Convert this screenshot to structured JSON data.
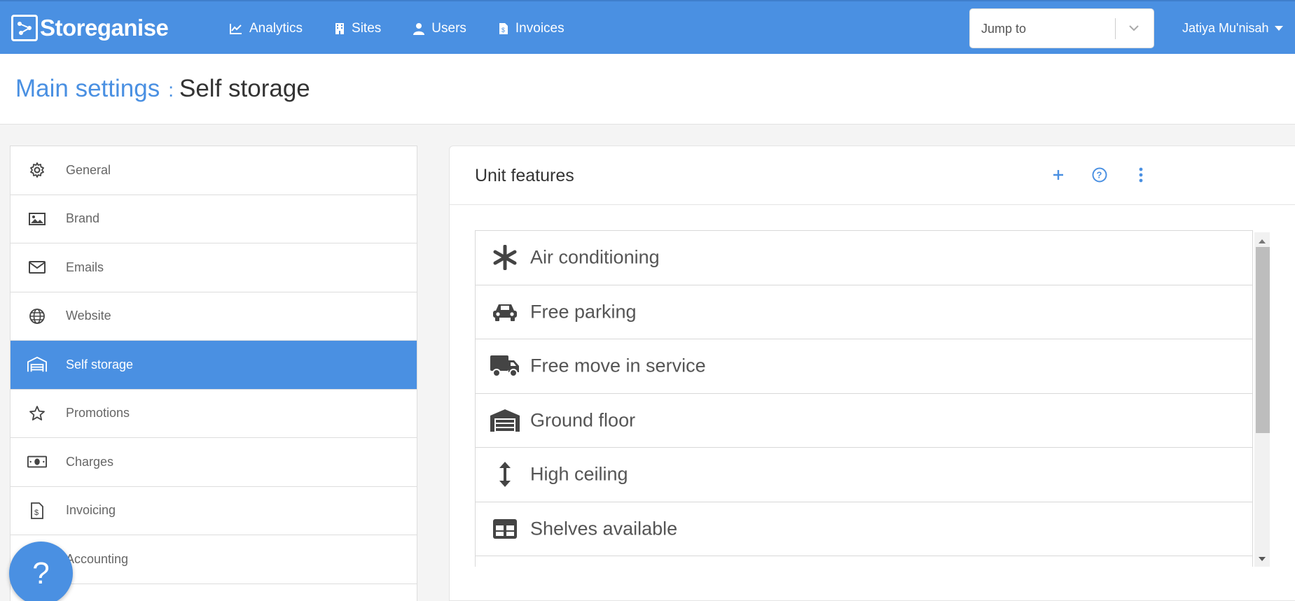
{
  "app": {
    "name": "Storeganise"
  },
  "nav": [
    {
      "label": "Analytics",
      "icon": "chart-line-icon"
    },
    {
      "label": "Sites",
      "icon": "building-icon"
    },
    {
      "label": "Users",
      "icon": "user-icon"
    },
    {
      "label": "Invoices",
      "icon": "invoice-icon"
    }
  ],
  "jump": {
    "placeholder": "Jump to"
  },
  "user": {
    "name": "Jatiya Mu'nisah"
  },
  "breadcrumb": {
    "parent": "Main settings",
    "separator": ":",
    "current": "Self storage"
  },
  "sidebar": {
    "items": [
      {
        "label": "General",
        "icon": "gear-icon",
        "active": false
      },
      {
        "label": "Brand",
        "icon": "image-icon",
        "active": false
      },
      {
        "label": "Emails",
        "icon": "envelope-icon",
        "active": false
      },
      {
        "label": "Website",
        "icon": "globe-icon",
        "active": false
      },
      {
        "label": "Self storage",
        "icon": "warehouse-icon",
        "active": true
      },
      {
        "label": "Promotions",
        "icon": "star-icon",
        "active": false
      },
      {
        "label": "Charges",
        "icon": "money-icon",
        "active": false
      },
      {
        "label": "Invoicing",
        "icon": "invoice-icon",
        "active": false
      },
      {
        "label": "Accounting",
        "icon": "accounting-icon",
        "active": false
      }
    ]
  },
  "help": {
    "label": "?"
  },
  "card": {
    "title": "Unit features",
    "actions": [
      "plus-icon",
      "question-circle-icon",
      "more-vertical-icon"
    ]
  },
  "features": [
    {
      "label": "Air conditioning",
      "icon": "asterisk-icon"
    },
    {
      "label": "Free parking",
      "icon": "car-icon"
    },
    {
      "label": "Free move in service",
      "icon": "truck-icon"
    },
    {
      "label": "Ground floor",
      "icon": "warehouse-icon"
    },
    {
      "label": "High ceiling",
      "icon": "arrows-vertical-icon"
    },
    {
      "label": "Shelves available",
      "icon": "table-icon"
    }
  ],
  "colors": {
    "primary": "#4a90e2",
    "text": "#333333",
    "muted": "#666666"
  }
}
